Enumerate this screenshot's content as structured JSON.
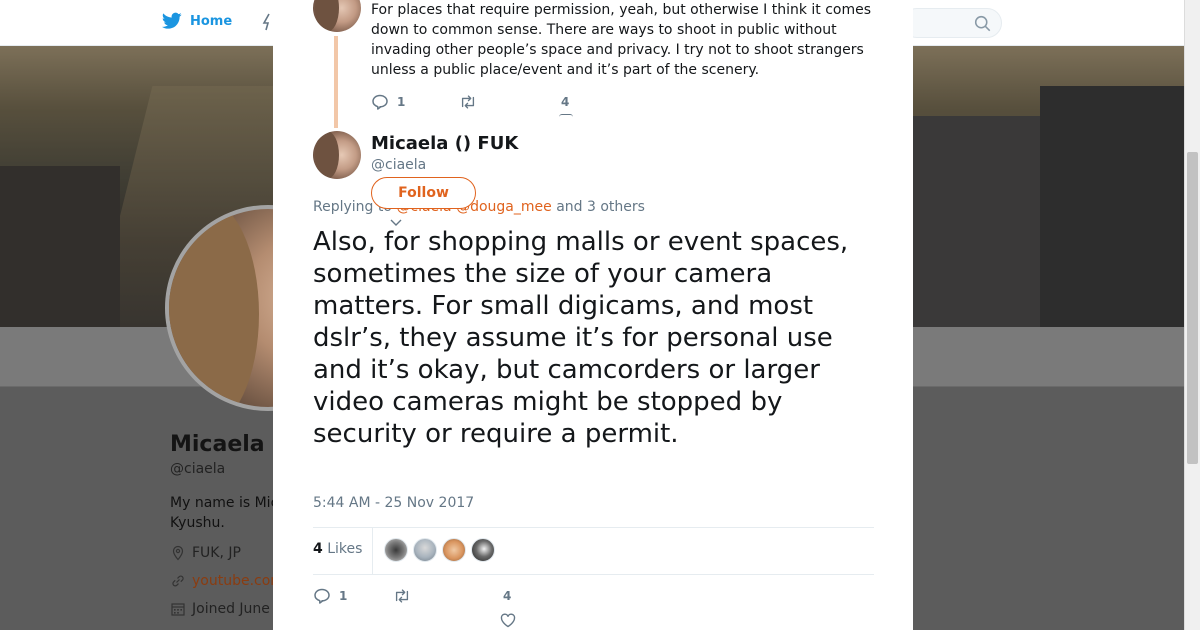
{
  "nav": {
    "home_label": "Home"
  },
  "profile": {
    "name": "Micaela (",
    "handle": "@ciaela",
    "bio": "My name is Mic\nKyushu.",
    "location": "FUK, JP",
    "url": "youtube.com",
    "joined": "Joined June"
  },
  "previous_tweet": {
    "text": "For places that require permission, yeah, but otherwise I think it comes down to common sense. There are ways to shoot in public without invading other people’s space and privacy. I try not to shoot strangers unless a public place/event and it’s part of the scenery.",
    "reply_count": "1",
    "like_count": "4"
  },
  "tweet": {
    "author_name": "Micaela () FUK",
    "author_handle": "@ciaela",
    "follow_label": "Follow",
    "replying_prefix": "Replying to",
    "replying_to_1": "@ciaela",
    "replying_to_2": "@douga_mee",
    "replying_suffix": "and 3 others",
    "text": "Also, for shopping malls or event spaces, sometimes the size of your camera matters. For small digicams, and most dslr’s, they assume it’s for personal use and it’s okay, but camcorders or larger video cameras might be stopped by security or require a permit.",
    "timestamp": "5:44 AM - 25 Nov 2017",
    "likes_count": "4",
    "likes_label": "Likes",
    "reply_count": "1",
    "like_count": "4"
  },
  "colors": {
    "accent": "#e0631e",
    "muted": "#657786",
    "text": "#14171a"
  }
}
